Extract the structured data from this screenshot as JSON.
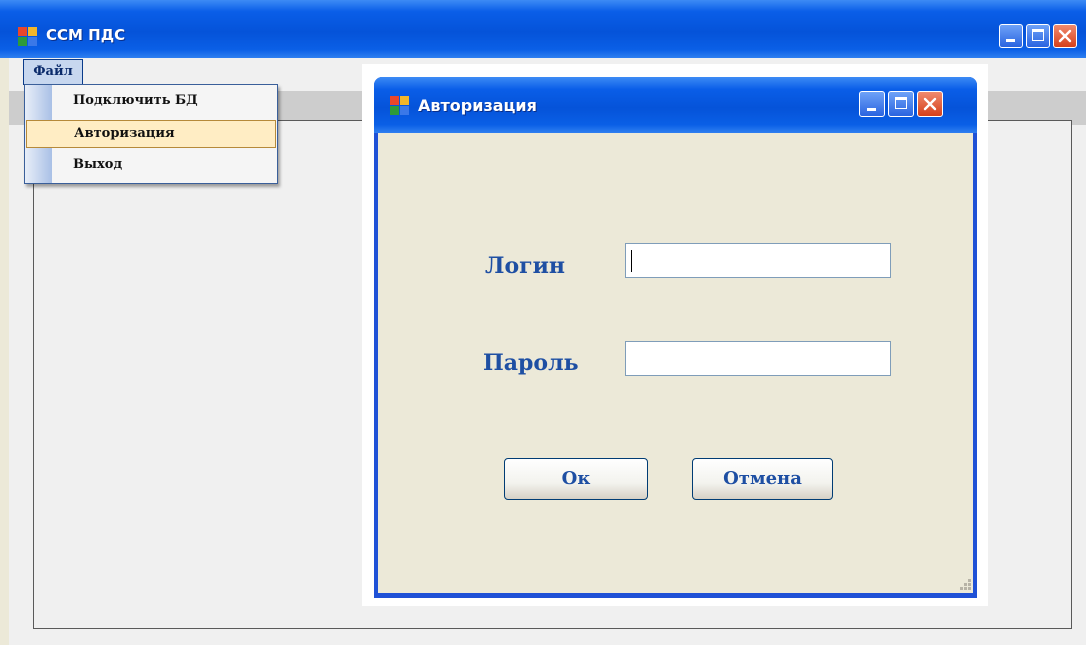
{
  "main_window": {
    "title": "ССМ ПДС"
  },
  "menubar": {
    "file_label": "Файл"
  },
  "file_menu": {
    "items": [
      {
        "label": "Подключить БД",
        "selected": false
      },
      {
        "label": "Авторизация",
        "selected": true
      },
      {
        "label": "Выход",
        "selected": false
      }
    ]
  },
  "dialog": {
    "title": "Авторизация",
    "login_label": "Логин",
    "login_value": "",
    "password_label": "Пароль",
    "password_value": "",
    "ok_label": "Ок",
    "cancel_label": "Отмена"
  },
  "colors": {
    "titlebar": "#0553d9",
    "label_text": "#1e4fa3",
    "menu_highlight": "#ffedc4",
    "dialog_body": "#ece9d8"
  },
  "icons": {
    "app": "app-icon",
    "minimize": "minimize-icon",
    "maximize": "maximize-icon",
    "close": "close-icon"
  }
}
